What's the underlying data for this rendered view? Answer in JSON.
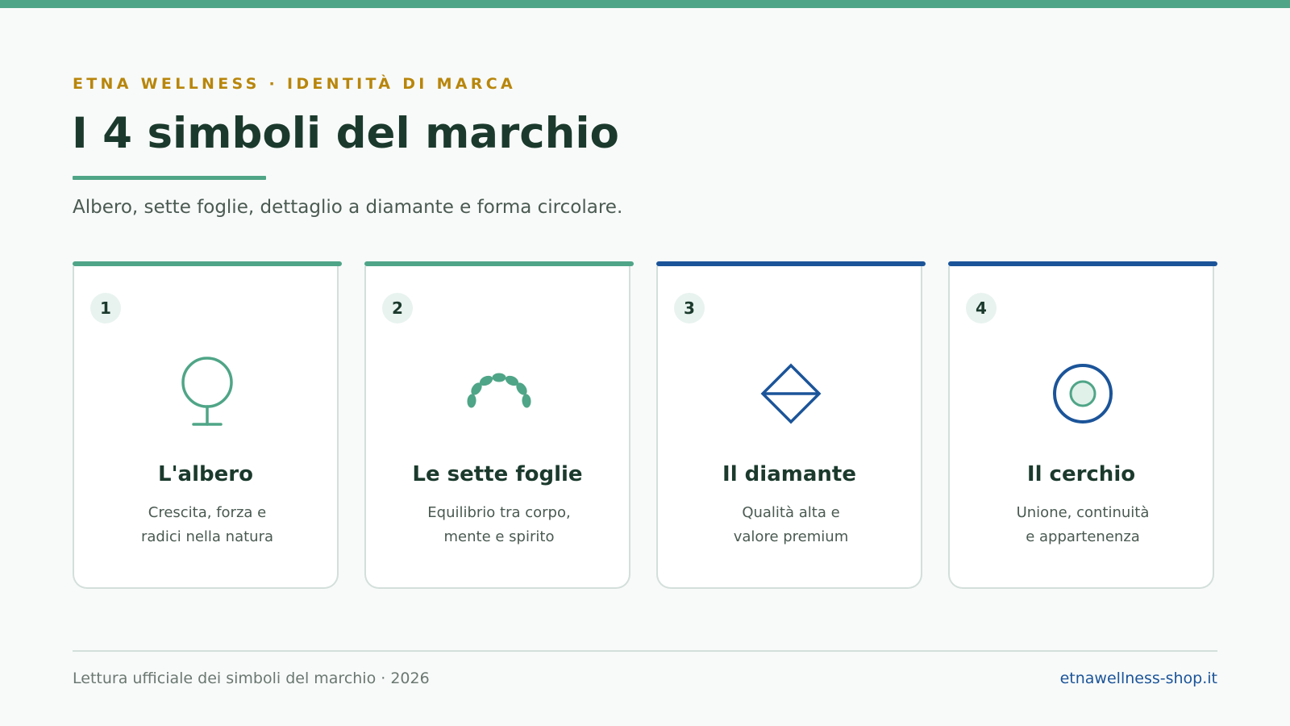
{
  "header": {
    "eyebrow": "ETNA WELLNESS · IDENTITÀ DI MARCA",
    "title": "I 4 simboli del marchio",
    "subtitle": "Albero, sette foglie, dettaglio a diamante e forma circolare."
  },
  "colors": {
    "green": "#4fa587",
    "blue": "#1b5499",
    "gold": "#b8860b",
    "dark": "#1b3a2d"
  },
  "cards": [
    {
      "number": "1",
      "icon": "tree-icon",
      "title": "L'albero",
      "desc_line1": "Crescita, forza e",
      "desc_line2": "radici nella natura",
      "accent": "#4fa587"
    },
    {
      "number": "2",
      "icon": "seven-leaves-icon",
      "title": "Le sette foglie",
      "desc_line1": "Equilibrio tra corpo,",
      "desc_line2": "mente e spirito",
      "accent": "#4fa587"
    },
    {
      "number": "3",
      "icon": "diamond-icon",
      "title": "Il diamante",
      "desc_line1": "Qualità alta e",
      "desc_line2": "valore premium",
      "accent": "#1b5499"
    },
    {
      "number": "4",
      "icon": "circle-icon",
      "title": "Il cerchio",
      "desc_line1": "Unione, continuità",
      "desc_line2": "e appartenenza",
      "accent": "#1b5499"
    }
  ],
  "footer": {
    "left": "Lettura ufficiale dei simboli del marchio · 2026",
    "right": "etnawellness-shop.it"
  }
}
